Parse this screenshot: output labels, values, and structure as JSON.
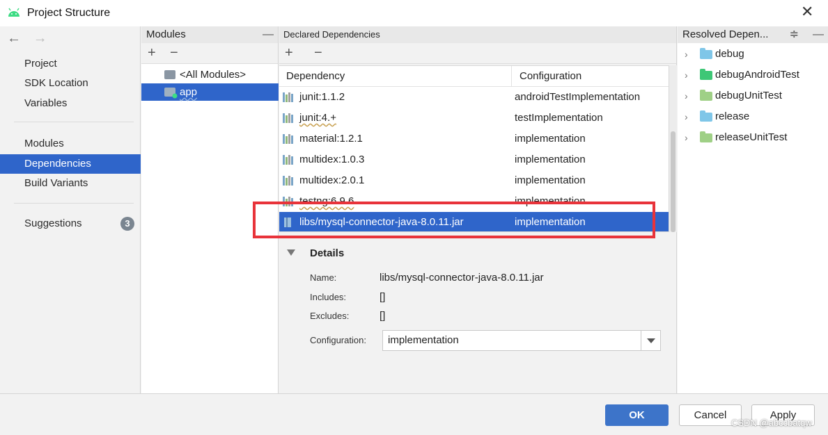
{
  "window": {
    "title": "Project Structure",
    "close_glyph": "✕"
  },
  "nav": {
    "back_glyph": "←",
    "forward_glyph": "→",
    "items": [
      {
        "label": "Project"
      },
      {
        "label": "SDK Location"
      },
      {
        "label": "Variables"
      },
      {
        "label": "Modules"
      },
      {
        "label": "Dependencies"
      },
      {
        "label": "Build Variants"
      },
      {
        "label": "Suggestions",
        "badge": "3"
      }
    ],
    "selected": "Dependencies"
  },
  "modules_panel": {
    "header": "Modules",
    "minus_glyph": "—",
    "add_glyph": "+",
    "remove_glyph": "−",
    "items": [
      {
        "label": "<All Modules>"
      },
      {
        "label": "app"
      }
    ],
    "selected": "app"
  },
  "declared": {
    "header": "Declared Dependencies",
    "add_glyph": "+",
    "remove_glyph": "−",
    "columns": {
      "dependency": "Dependency",
      "configuration": "Configuration"
    },
    "rows": [
      {
        "name": "junit:1.1.2",
        "config": "androidTestImplementation"
      },
      {
        "name": "junit:4.+",
        "config": "testImplementation"
      },
      {
        "name": "material:1.2.1",
        "config": "implementation"
      },
      {
        "name": "multidex:1.0.3",
        "config": "implementation"
      },
      {
        "name": "multidex:2.0.1",
        "config": "implementation"
      },
      {
        "name": "testng:6.9.6",
        "config": "implementation"
      },
      {
        "name": "libs/mysql-connector-java-8.0.11.jar",
        "config": "implementation"
      }
    ],
    "selected": "libs/mysql-connector-java-8.0.11.jar"
  },
  "details": {
    "title": "Details",
    "name_label": "Name:",
    "name_value": "libs/mysql-connector-java-8.0.11.jar",
    "includes_label": "Includes:",
    "includes_value": "[]",
    "excludes_label": "Excludes:",
    "excludes_value": "[]",
    "configuration_label": "Configuration:",
    "configuration_value": "implementation"
  },
  "resolved": {
    "header": "Resolved Depen...",
    "minus_glyph": "—",
    "collapse_glyph": "≑",
    "items": [
      {
        "label": "debug",
        "color": "#7fc6e8"
      },
      {
        "label": "debugAndroidTest",
        "color": "#3ec776"
      },
      {
        "label": "debugUnitTest",
        "color": "#9fd086"
      },
      {
        "label": "release",
        "color": "#7fc6e8"
      },
      {
        "label": "releaseUnitTest",
        "color": "#9fd086"
      }
    ]
  },
  "footer": {
    "ok": "OK",
    "cancel": "Cancel",
    "apply": "Apply",
    "watermark": "CSDN @abccbatqw"
  },
  "colors": {
    "selection": "#2f65ca",
    "highlight_border": "#e8333a",
    "ok_button": "#3d74c9"
  }
}
